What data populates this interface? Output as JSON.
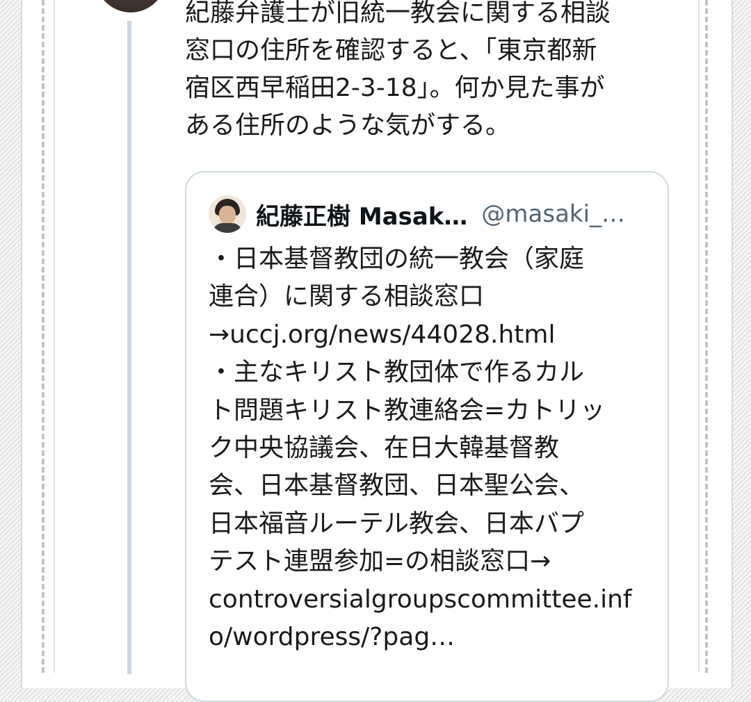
{
  "tweet": {
    "text_lines": [
      "紀藤弁護士が旧統一教会に関する相談",
      "窓口の住所を確認すると、「東京都新",
      "宿区西早稲田2-3-18」。何か見た事が",
      "ある住所のような気がする。"
    ]
  },
  "quote": {
    "author_name": "紀藤正樹 Masak…",
    "author_handle": "@masaki_…",
    "body_lines": [
      "・日本基督教団の統一教会（家庭",
      "連合）に関する相談窓口",
      "→uccj.org/news/44028.html",
      "・主なキリスト教団体で作るカル",
      "ト問題キリスト教連絡会=カトリッ",
      "ク中央協議会、在日大韓基督教",
      "会、日本基督教団、日本聖公会、",
      "日本福音ルーテル教会、日本バプ",
      "テスト連盟参加=の相談窓口→",
      "controversialgroupscommittee.inf",
      "o/wordpress/?pag…"
    ]
  },
  "icons": {
    "self_avatar": "user-avatar-icon",
    "quote_avatar": "quoted-user-avatar-icon"
  },
  "colors": {
    "text": "#1a1a1a",
    "handle": "#536471",
    "card_border": "#cfd9de",
    "thread_line": "#cfd6dd"
  }
}
